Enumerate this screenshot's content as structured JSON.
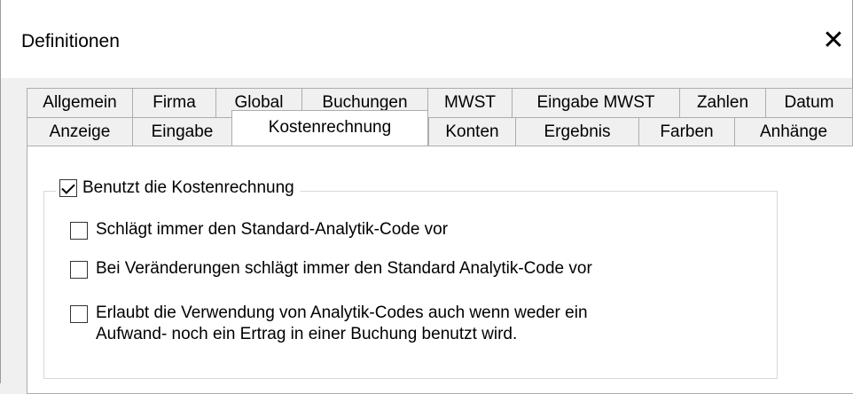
{
  "window": {
    "title": "Definitionen",
    "close_glyph": "✕"
  },
  "tabs_back": [
    "Allgemein",
    "Firma",
    "Global",
    "Buchungen",
    "MWST",
    "Eingabe MWST",
    "Zahlen",
    "Datum"
  ],
  "tabs_front": [
    "Anzeige",
    "Eingabe",
    "Kostenrechnung",
    "Konten",
    "Ergebnis",
    "Farben",
    "Anhänge"
  ],
  "active_tab": "Kostenrechnung",
  "group": {
    "label": "Benutzt die Kostenrechnung",
    "checked": true
  },
  "options": [
    {
      "label": "Schlägt immer den Standard-Analytik-Code vor",
      "checked": false
    },
    {
      "label": "Bei Veränderungen schlägt immer den Standard Analytik-Code vor",
      "checked": false
    },
    {
      "label": "Erlaubt die Verwendung von Analytik-Codes auch wenn weder ein\nAufwand- noch ein Ertrag in einer Buchung benutzt wird.",
      "checked": false
    }
  ]
}
